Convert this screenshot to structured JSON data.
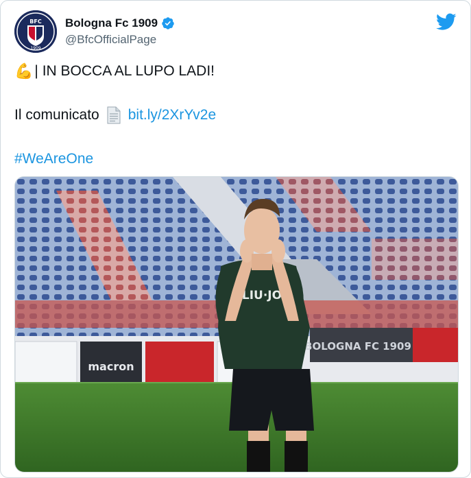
{
  "tweet": {
    "display_name": "Bologna Fc 1909",
    "handle": "@BfcOfficialPage",
    "lines": {
      "line1_emoji": "💪",
      "line1_text": "| IN BOCCA AL LUPO LADI!",
      "line2_text": "Il comunicato",
      "line2_link": "bit.ly/2XrYv2e",
      "line3_hashtag": "#WeAreOne"
    },
    "avatar_text": "BFC",
    "avatar_year": "1909",
    "media": {
      "jersey_text": "LIU·JO",
      "ad_1": "macron",
      "ad_2": "BOLOGNA FC 1909"
    }
  },
  "colors": {
    "link": "#1b95e0",
    "verified": "#1d9bf0",
    "twitter_bird": "#1d9bf0",
    "pitch": "#3e7a2a",
    "seats_blue": "#3d5a9a",
    "seats_red": "#c9574d",
    "jersey": "#213a2c"
  },
  "icons": [
    "twitter-bird-icon",
    "verified-badge-icon",
    "document-icon",
    "flexed-biceps-emoji"
  ]
}
